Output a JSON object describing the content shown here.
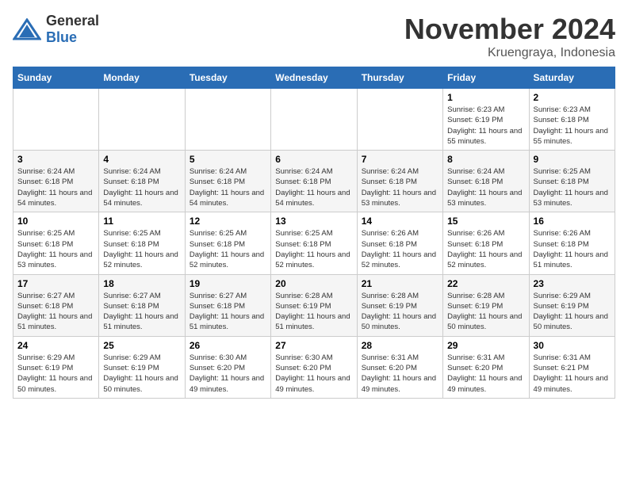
{
  "logo": {
    "text_general": "General",
    "text_blue": "Blue"
  },
  "title": {
    "month": "November 2024",
    "location": "Kruengraya, Indonesia"
  },
  "weekdays": [
    "Sunday",
    "Monday",
    "Tuesday",
    "Wednesday",
    "Thursday",
    "Friday",
    "Saturday"
  ],
  "weeks": [
    [
      {
        "day": "",
        "info": ""
      },
      {
        "day": "",
        "info": ""
      },
      {
        "day": "",
        "info": ""
      },
      {
        "day": "",
        "info": ""
      },
      {
        "day": "",
        "info": ""
      },
      {
        "day": "1",
        "info": "Sunrise: 6:23 AM\nSunset: 6:19 PM\nDaylight: 11 hours and 55 minutes."
      },
      {
        "day": "2",
        "info": "Sunrise: 6:23 AM\nSunset: 6:18 PM\nDaylight: 11 hours and 55 minutes."
      }
    ],
    [
      {
        "day": "3",
        "info": "Sunrise: 6:24 AM\nSunset: 6:18 PM\nDaylight: 11 hours and 54 minutes."
      },
      {
        "day": "4",
        "info": "Sunrise: 6:24 AM\nSunset: 6:18 PM\nDaylight: 11 hours and 54 minutes."
      },
      {
        "day": "5",
        "info": "Sunrise: 6:24 AM\nSunset: 6:18 PM\nDaylight: 11 hours and 54 minutes."
      },
      {
        "day": "6",
        "info": "Sunrise: 6:24 AM\nSunset: 6:18 PM\nDaylight: 11 hours and 54 minutes."
      },
      {
        "day": "7",
        "info": "Sunrise: 6:24 AM\nSunset: 6:18 PM\nDaylight: 11 hours and 53 minutes."
      },
      {
        "day": "8",
        "info": "Sunrise: 6:24 AM\nSunset: 6:18 PM\nDaylight: 11 hours and 53 minutes."
      },
      {
        "day": "9",
        "info": "Sunrise: 6:25 AM\nSunset: 6:18 PM\nDaylight: 11 hours and 53 minutes."
      }
    ],
    [
      {
        "day": "10",
        "info": "Sunrise: 6:25 AM\nSunset: 6:18 PM\nDaylight: 11 hours and 53 minutes."
      },
      {
        "day": "11",
        "info": "Sunrise: 6:25 AM\nSunset: 6:18 PM\nDaylight: 11 hours and 52 minutes."
      },
      {
        "day": "12",
        "info": "Sunrise: 6:25 AM\nSunset: 6:18 PM\nDaylight: 11 hours and 52 minutes."
      },
      {
        "day": "13",
        "info": "Sunrise: 6:25 AM\nSunset: 6:18 PM\nDaylight: 11 hours and 52 minutes."
      },
      {
        "day": "14",
        "info": "Sunrise: 6:26 AM\nSunset: 6:18 PM\nDaylight: 11 hours and 52 minutes."
      },
      {
        "day": "15",
        "info": "Sunrise: 6:26 AM\nSunset: 6:18 PM\nDaylight: 11 hours and 52 minutes."
      },
      {
        "day": "16",
        "info": "Sunrise: 6:26 AM\nSunset: 6:18 PM\nDaylight: 11 hours and 51 minutes."
      }
    ],
    [
      {
        "day": "17",
        "info": "Sunrise: 6:27 AM\nSunset: 6:18 PM\nDaylight: 11 hours and 51 minutes."
      },
      {
        "day": "18",
        "info": "Sunrise: 6:27 AM\nSunset: 6:18 PM\nDaylight: 11 hours and 51 minutes."
      },
      {
        "day": "19",
        "info": "Sunrise: 6:27 AM\nSunset: 6:18 PM\nDaylight: 11 hours and 51 minutes."
      },
      {
        "day": "20",
        "info": "Sunrise: 6:28 AM\nSunset: 6:19 PM\nDaylight: 11 hours and 51 minutes."
      },
      {
        "day": "21",
        "info": "Sunrise: 6:28 AM\nSunset: 6:19 PM\nDaylight: 11 hours and 50 minutes."
      },
      {
        "day": "22",
        "info": "Sunrise: 6:28 AM\nSunset: 6:19 PM\nDaylight: 11 hours and 50 minutes."
      },
      {
        "day": "23",
        "info": "Sunrise: 6:29 AM\nSunset: 6:19 PM\nDaylight: 11 hours and 50 minutes."
      }
    ],
    [
      {
        "day": "24",
        "info": "Sunrise: 6:29 AM\nSunset: 6:19 PM\nDaylight: 11 hours and 50 minutes."
      },
      {
        "day": "25",
        "info": "Sunrise: 6:29 AM\nSunset: 6:19 PM\nDaylight: 11 hours and 50 minutes."
      },
      {
        "day": "26",
        "info": "Sunrise: 6:30 AM\nSunset: 6:20 PM\nDaylight: 11 hours and 49 minutes."
      },
      {
        "day": "27",
        "info": "Sunrise: 6:30 AM\nSunset: 6:20 PM\nDaylight: 11 hours and 49 minutes."
      },
      {
        "day": "28",
        "info": "Sunrise: 6:31 AM\nSunset: 6:20 PM\nDaylight: 11 hours and 49 minutes."
      },
      {
        "day": "29",
        "info": "Sunrise: 6:31 AM\nSunset: 6:20 PM\nDaylight: 11 hours and 49 minutes."
      },
      {
        "day": "30",
        "info": "Sunrise: 6:31 AM\nSunset: 6:21 PM\nDaylight: 11 hours and 49 minutes."
      }
    ]
  ]
}
